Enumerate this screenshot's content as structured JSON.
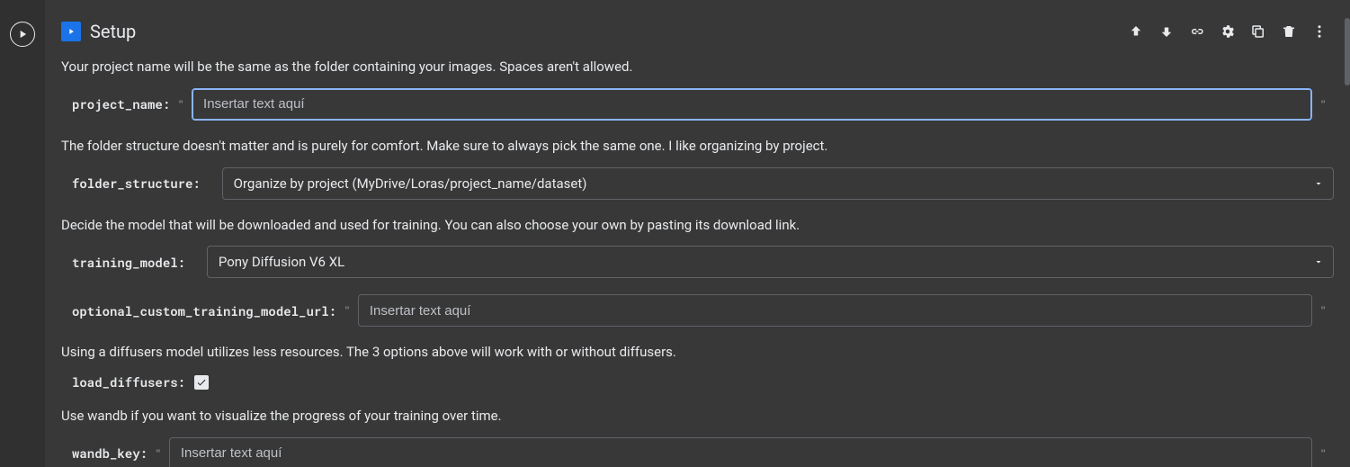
{
  "header": {
    "title": "Setup"
  },
  "descriptions": {
    "project_name": "Your project name will be the same as the folder containing your images. Spaces aren't allowed.",
    "folder_structure": "The folder structure doesn't matter and is purely for comfort. Make sure to always pick the same one. I like organizing by project.",
    "training_model": "Decide the model that will be downloaded and used for training. You can also choose your own by pasting its download link.",
    "load_diffusers": "Using a diffusers model utilizes less resources. The 3 options above will work with or without diffusers.",
    "wandb_key": "Use wandb if you want to visualize the progress of your training over time."
  },
  "fields": {
    "project_name": {
      "label": "project_name:",
      "placeholder": "Insertar text aquí",
      "value": ""
    },
    "folder_structure": {
      "label": "folder_structure:",
      "value": "Organize by project (MyDrive/Loras/project_name/dataset)"
    },
    "training_model": {
      "label": "training_model:",
      "value": "Pony Diffusion V6 XL"
    },
    "optional_custom_training_model_url": {
      "label": "optional_custom_training_model_url:",
      "placeholder": "Insertar text aquí",
      "value": ""
    },
    "load_diffusers": {
      "label": "load_diffusers:",
      "checked": true
    },
    "wandb_key": {
      "label": "wandb_key:",
      "placeholder": "Insertar text aquí",
      "value": ""
    }
  },
  "quote": "\""
}
